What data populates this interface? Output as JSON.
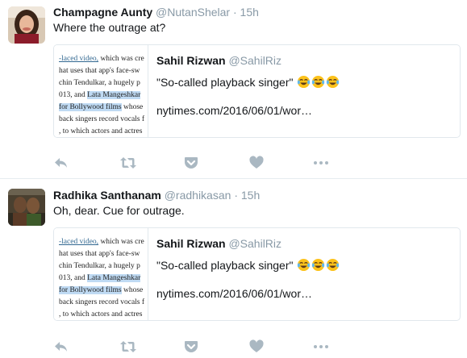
{
  "tweets": [
    {
      "name": "Champagne Aunty",
      "handle": "@NutanShelar",
      "dot": "·",
      "time": "15h",
      "text": "Where the outrage at?",
      "quote": {
        "name": "Sahil Rizwan",
        "handle": "@SahilRiz",
        "text": "\"So-called playback singer\"",
        "emoji": [
          "face-with-tears-of-joy-icon",
          "face-with-tears-of-joy-icon",
          "face-with-tears-of-joy-icon"
        ],
        "url": "nytimes.com/2016/06/01/wor…",
        "article_lines": [
          {
            "pre": "",
            "link": "-laced video,",
            "post": " which was cre"
          },
          {
            "pre": "hat uses that app's face-sw",
            "link": "",
            "post": ""
          },
          {
            "pre": "chin Tendulkar, a hugely p",
            "link": "",
            "post": ""
          },
          {
            "pre": "013, and ",
            "hl": "Lata Mangeshkar",
            "post": ""
          },
          {
            "pre": "",
            "hl": "for Bollywood films",
            "post": " whose"
          },
          {
            "pre": "back singers record vocals f",
            "link": "",
            "post": ""
          },
          {
            "pre": ", to which actors and actres",
            "link": "",
            "post": ""
          }
        ]
      }
    },
    {
      "name": "Radhika Santhanam",
      "handle": "@radhikasan",
      "dot": "·",
      "time": "15h",
      "text": "Oh, dear. Cue for outrage.",
      "quote": {
        "name": "Sahil Rizwan",
        "handle": "@SahilRiz",
        "text": "\"So-called playback singer\"",
        "emoji": [
          "face-with-tears-of-joy-icon",
          "face-with-tears-of-joy-icon",
          "face-with-tears-of-joy-icon"
        ],
        "url": "nytimes.com/2016/06/01/wor…",
        "article_lines": [
          {
            "pre": "",
            "link": "-laced video,",
            "post": " which was cre"
          },
          {
            "pre": "hat uses that app's face-sw",
            "link": "",
            "post": ""
          },
          {
            "pre": "chin Tendulkar, a hugely p",
            "link": "",
            "post": ""
          },
          {
            "pre": "013, and ",
            "hl": "Lata Mangeshkar",
            "post": ""
          },
          {
            "pre": "",
            "hl": "for Bollywood films",
            "post": " whose"
          },
          {
            "pre": "back singers record vocals f",
            "link": "",
            "post": ""
          },
          {
            "pre": ", to which actors and actres",
            "link": "",
            "post": ""
          }
        ]
      }
    }
  ],
  "actions": [
    "reply-icon",
    "retweet-icon",
    "pocket-icon",
    "like-icon",
    "more-icon"
  ],
  "colors": {
    "action_gray": "#aab8c2",
    "secondary_text": "#8899a6",
    "border": "#e1e8ed",
    "highlight": "#bfdaf3"
  }
}
